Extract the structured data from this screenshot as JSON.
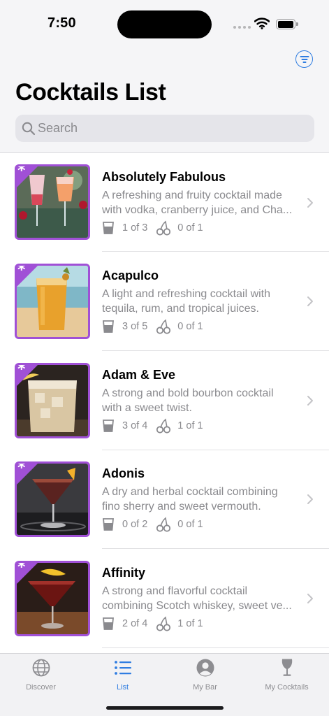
{
  "status_bar": {
    "time": "7:50"
  },
  "header": {
    "title": "Cocktails List"
  },
  "search": {
    "placeholder": "Search"
  },
  "colors": {
    "accent": "#2f7de1",
    "badge": "#a050d6",
    "secondary_text": "#8a8a8e"
  },
  "cocktails": [
    {
      "name": "Absolutely Fabulous",
      "desc_line1": "A refreshing and fruity cocktail made",
      "desc_line2": "with vodka, cranberry juice, and Cha...",
      "ingredients": "1 of 3",
      "garnish": "0 of 1",
      "badge": "*"
    },
    {
      "name": "Acapulco",
      "desc_line1": "A light and refreshing cocktail with",
      "desc_line2": "tequila, rum, and tropical juices.",
      "ingredients": "3 of 5",
      "garnish": "0 of 1",
      "badge": "*"
    },
    {
      "name": "Adam & Eve",
      "desc_line1": "A strong and bold bourbon cocktail",
      "desc_line2": "with a sweet twist.",
      "ingredients": "3 of 4",
      "garnish": "1 of 1",
      "badge": "*"
    },
    {
      "name": "Adonis",
      "desc_line1": "A dry and herbal cocktail combining",
      "desc_line2": "fino sherry and sweet vermouth.",
      "ingredients": "0 of 2",
      "garnish": "0 of 1",
      "badge": "*"
    },
    {
      "name": "Affinity",
      "desc_line1": "A strong and flavorful cocktail",
      "desc_line2": "combining Scotch whiskey, sweet ve...",
      "ingredients": "2 of 4",
      "garnish": "1 of 1",
      "badge": "*"
    }
  ],
  "tabs": [
    {
      "label": "Discover",
      "icon": "globe-icon",
      "active": false
    },
    {
      "label": "List",
      "icon": "list-icon",
      "active": true
    },
    {
      "label": "My Bar",
      "icon": "person-circle-icon",
      "active": false
    },
    {
      "label": "My Cocktails",
      "icon": "wineglass-icon",
      "active": false
    }
  ]
}
